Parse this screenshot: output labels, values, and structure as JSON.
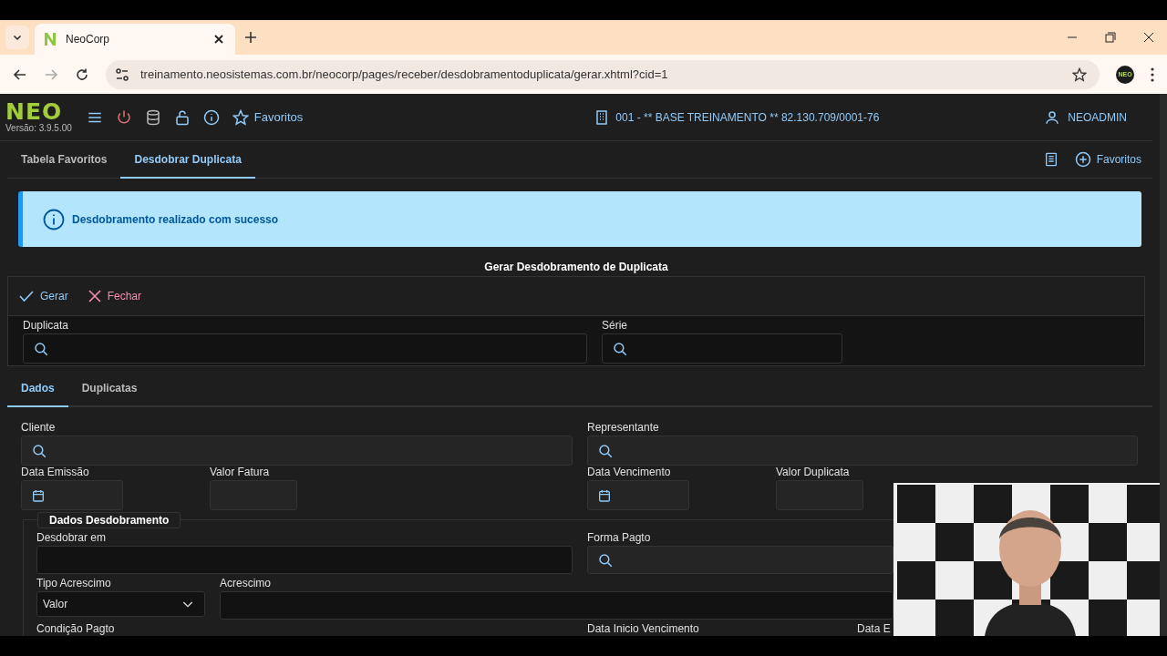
{
  "browser": {
    "tab_title": "NeoCorp",
    "url": "treinamento.neosistemas.com.br/neocorp/pages/receber/desdobramentoduplicata/gerar.xhtml?cid=1",
    "profile_label": "NEO"
  },
  "header": {
    "logo": "NEO",
    "version": "Versão: 3.9.5.00",
    "favorites": "Favoritos",
    "company": "001 - ** BASE TREINAMENTO ** 82.130.709/0001-76",
    "user": "NEOADMIN"
  },
  "page_tabs": [
    {
      "label": "Tabela Favoritos",
      "selected": false
    },
    {
      "label": "Desdobrar Duplicata",
      "selected": true
    }
  ],
  "page_favorites": "Favoritos",
  "message": {
    "text": "Desdobramento realizado com sucesso"
  },
  "panel": {
    "title": "Gerar Desdobramento de Duplicata",
    "actions": [
      {
        "label": "Gerar",
        "kind": "confirm"
      },
      {
        "label": "Fechar",
        "kind": "cancel"
      }
    ],
    "filters": [
      {
        "label": "Duplicata",
        "kind": "search"
      },
      {
        "label": "Série",
        "kind": "search"
      }
    ]
  },
  "form_tabs": [
    {
      "label": "Dados",
      "selected": true
    },
    {
      "label": "Duplicatas",
      "selected": false
    }
  ],
  "fields": [
    {
      "label": "Cliente",
      "kind": "search"
    },
    {
      "label": "Representante",
      "kind": "search"
    },
    {
      "label": "Data Emissão",
      "kind": "date"
    },
    {
      "label": "Valor Fatura",
      "kind": "amount"
    },
    {
      "label": "Data Vencimento",
      "kind": "date"
    },
    {
      "label": "Valor Duplicata",
      "kind": "amount"
    }
  ],
  "fieldset": {
    "legend": "Dados Desdobramento",
    "fields": [
      {
        "label": "Desdobrar em",
        "kind": "text"
      },
      {
        "label": "Forma Pagto",
        "kind": "search"
      },
      {
        "label": "Tipo Acrescimo",
        "kind": "select",
        "value": "Valor"
      },
      {
        "label": "Acrescimo",
        "kind": "text"
      },
      {
        "label": "Condição Pagto",
        "kind": "cut"
      },
      {
        "label": "Data Inicio Vencimento",
        "kind": "cut"
      },
      {
        "label": "Data E",
        "kind": "cut"
      }
    ]
  }
}
